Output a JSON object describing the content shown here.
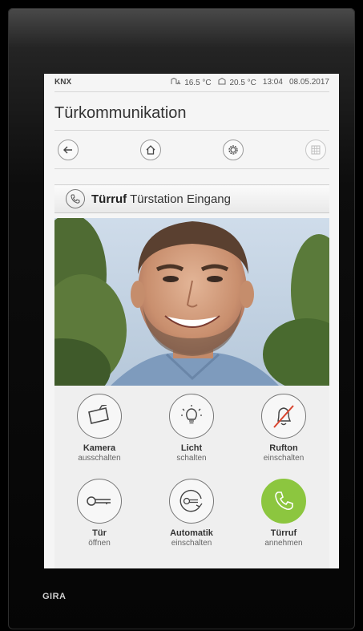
{
  "device": {
    "brand": "GIRA"
  },
  "status_bar": {
    "system": "KNX",
    "temp_1": "16.5 °C",
    "temp_2": "20.5 °C",
    "time": "13:04",
    "date": "08.05.2017"
  },
  "page": {
    "title": "Türkommunikation"
  },
  "nav": {
    "icons": [
      "back-icon",
      "home-icon",
      "settings-icon",
      "grid-icon"
    ]
  },
  "call_bar": {
    "label_bold": "Türruf",
    "label_rest": "Türstation Eingang"
  },
  "actions": [
    {
      "line1": "Kamera",
      "line2": "ausschalten",
      "icon": "camera-icon"
    },
    {
      "line1": "Licht",
      "line2": "schalten",
      "icon": "light-bulb-icon"
    },
    {
      "line1": "Rufton",
      "line2": "einschalten",
      "icon": "bell-muted-icon"
    },
    {
      "line1": "Tür",
      "line2": "öffnen",
      "icon": "key-icon"
    },
    {
      "line1": "Automatik",
      "line2": "einschalten",
      "icon": "auto-key-icon"
    },
    {
      "line1": "Türruf",
      "line2": "annehmen",
      "icon": "phone-icon"
    }
  ],
  "colors": {
    "accept_green": "#8cc63f",
    "background": "#f5f5f5"
  }
}
